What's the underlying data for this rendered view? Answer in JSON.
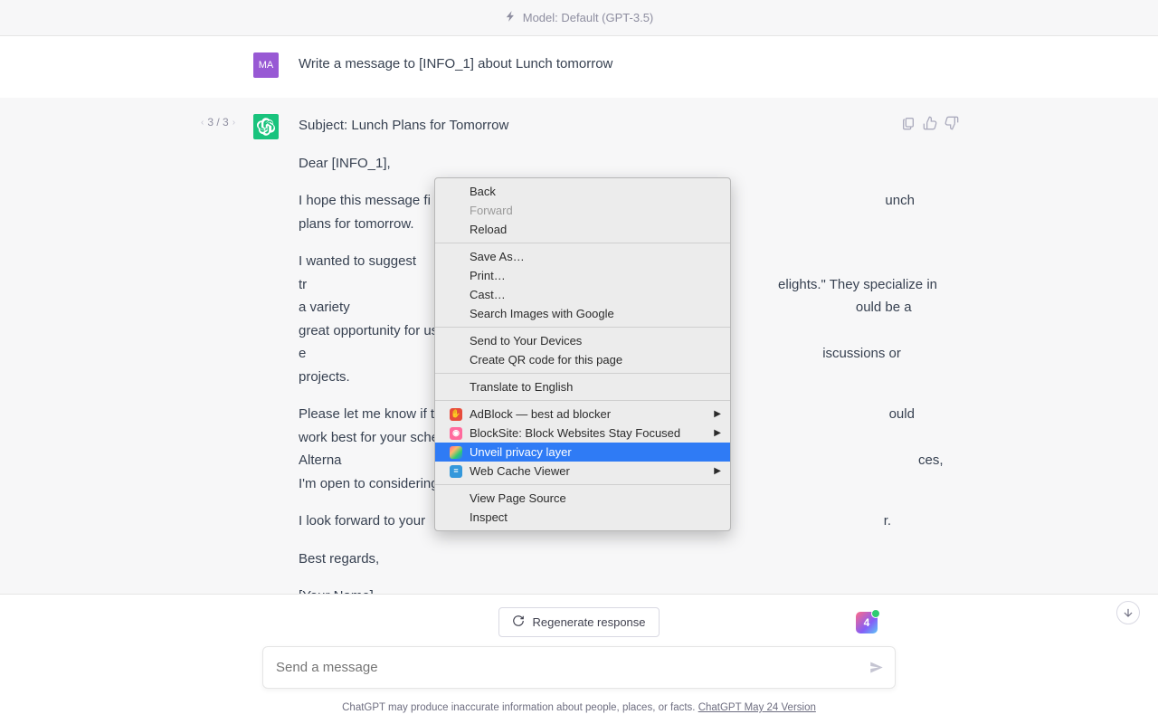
{
  "model_bar": {
    "label": "Model: Default (GPT-3.5)"
  },
  "user": {
    "initials": "MA",
    "prompt": "Write a message to [INFO_1] about Lunch tomorrow"
  },
  "pager": {
    "text": "3 / 3"
  },
  "assistant": {
    "subject": "Subject: Lunch Plans for Tomorrow",
    "p1": "Dear [INFO_1],",
    "p2a": "I hope this message fi",
    "p2b": "unch plans for tomorrow.",
    "p3a": "I wanted to suggest tr",
    "p3b": "elights.\" They specialize in a variety ",
    "p3c": "ould be a great opportunity for us to e",
    "p3d": "iscussions or projects.",
    "p4a": "Please let me know if t",
    "p4b": "ould work best for your schedule. Alterna",
    "p4c": "ces, I'm open to considering them.",
    "p5a": "I look forward to your ",
    "p5b": "r.",
    "p6": "Best regards,",
    "p7": "[Your Name]"
  },
  "regen": {
    "label": "Regenerate response"
  },
  "input": {
    "placeholder": "Send a message"
  },
  "disclaimer": {
    "text": "ChatGPT may produce inaccurate information about people, places, or facts. ",
    "link": "ChatGPT May 24 Version"
  },
  "ext_badge": "4",
  "context_menu": {
    "back": "Back",
    "forward": "Forward",
    "reload": "Reload",
    "save_as": "Save As…",
    "print": "Print…",
    "cast": "Cast…",
    "search_images": "Search Images with Google",
    "send_devices": "Send to Your Devices",
    "qr": "Create QR code for this page",
    "translate": "Translate to English",
    "adblock": "AdBlock — best ad blocker",
    "blocksite": "BlockSite: Block Websites  Stay Focused",
    "unveil": "Unveil privacy layer",
    "webcache": "Web Cache Viewer",
    "view_source": "View Page Source",
    "inspect": "Inspect"
  }
}
